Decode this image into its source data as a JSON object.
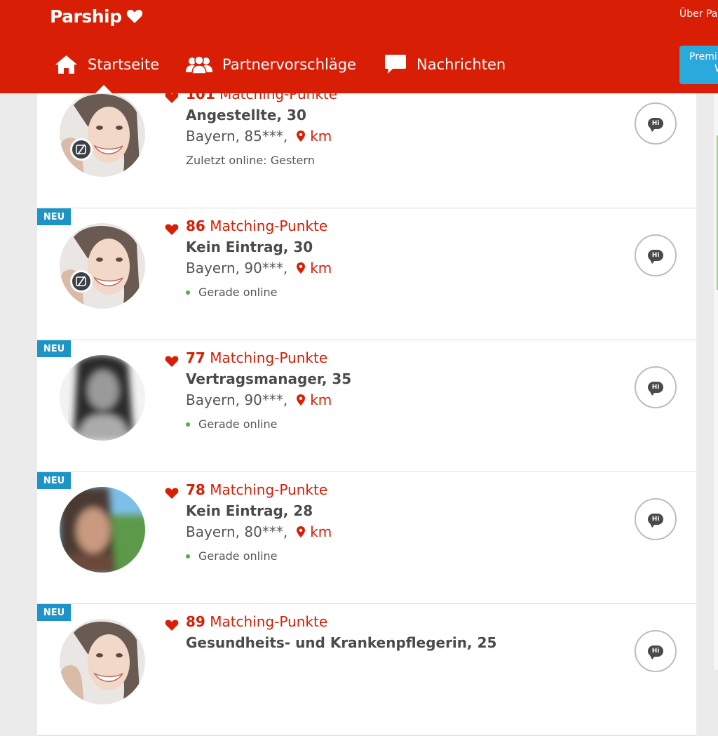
{
  "brand": {
    "name": "Parship"
  },
  "header": {
    "top_link": "Über Pa",
    "premium_line1": "Premi",
    "premium_line2": "W"
  },
  "nav": {
    "items": [
      {
        "label": "Startseite",
        "icon": "home-icon"
      },
      {
        "label": "Partnervorschläge",
        "icon": "people-icon"
      },
      {
        "label": "Nachrichten",
        "icon": "chat-icon"
      }
    ]
  },
  "profiles": [
    {
      "is_new": false,
      "badge": "",
      "points": "101",
      "points_label": "Matching-Punkte",
      "title": "Angestellte, 30",
      "location": "Bayern, 85***,",
      "km": "km",
      "status": "Zuletzt online: Gestern",
      "online": false,
      "avatar": "smiling-woman-photo",
      "verified_icon": true,
      "hi": "Hi"
    },
    {
      "is_new": true,
      "badge": "NEU",
      "points": "86",
      "points_label": "Matching-Punkte",
      "title": "Kein Eintrag, 30",
      "location": "Bayern, 90***,",
      "km": "km",
      "status": "Gerade online",
      "online": true,
      "avatar": "smiling-woman-photo",
      "verified_icon": true,
      "hi": "Hi"
    },
    {
      "is_new": true,
      "badge": "NEU",
      "points": "77",
      "points_label": "Matching-Punkte",
      "title": "Vertragsmanager, 35",
      "location": "Bayern, 90***,",
      "km": "km",
      "status": "Gerade online",
      "online": true,
      "avatar": "blurred-bw-photo",
      "verified_icon": false,
      "hi": "Hi"
    },
    {
      "is_new": true,
      "badge": "NEU",
      "points": "78",
      "points_label": "Matching-Punkte",
      "title": "Kein Eintrag, 28",
      "location": "Bayern, 80***,",
      "km": "km",
      "status": "Gerade online",
      "online": true,
      "avatar": "blurred-color-photo",
      "verified_icon": false,
      "hi": "Hi"
    },
    {
      "is_new": true,
      "badge": "NEU",
      "points": "89",
      "points_label": "Matching-Punkte",
      "title": "Gesundheits- und Krankenpflegerin, 25",
      "location": "",
      "km": "",
      "status": "",
      "online": false,
      "avatar": "smiling-woman-photo",
      "verified_icon": false,
      "hi": "Hi"
    }
  ],
  "colors": {
    "brand_red": "#d81e05",
    "badge_blue": "#1d94c8",
    "premium_blue": "#2aa9dd",
    "online_green": "#4cae4c"
  }
}
